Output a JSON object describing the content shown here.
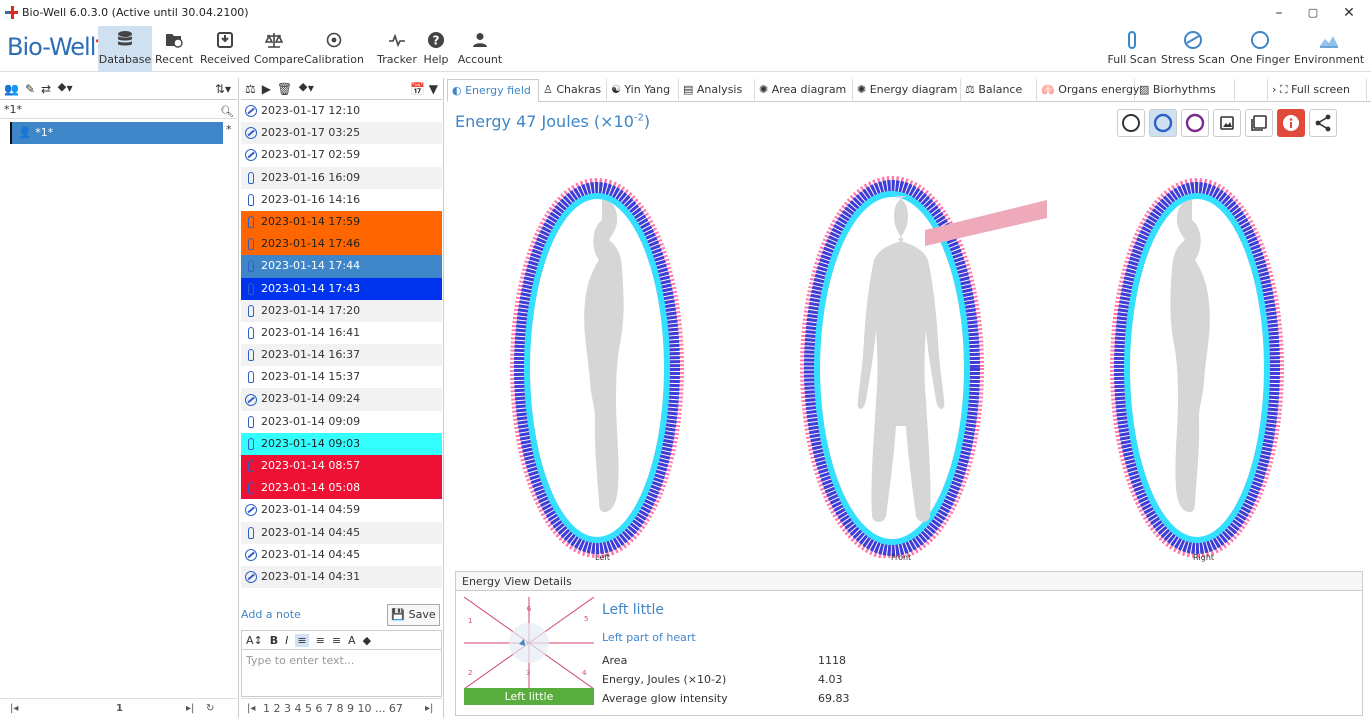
{
  "window": {
    "title": "Bio-Well 6.0.3.0 (Active until 30.04.2100)",
    "min": "–",
    "max": "▢",
    "close": "✕"
  },
  "brand": {
    "name": "Bio-Well",
    "mark": "✚"
  },
  "toolbar": {
    "left": [
      {
        "label": "Database",
        "icon": "database-icon"
      },
      {
        "label": "Recent",
        "icon": "recent-icon"
      },
      {
        "label": "Received",
        "icon": "received-icon"
      },
      {
        "label": "Compare",
        "icon": "compare-icon"
      },
      {
        "label": "Calibration",
        "icon": "calibration-icon"
      },
      {
        "label": "Tracker",
        "icon": "tracker-icon"
      },
      {
        "label": "Help",
        "icon": "help-icon"
      },
      {
        "label": "Account",
        "icon": "account-icon"
      }
    ],
    "right": [
      {
        "label": "Full Scan",
        "icon": "full-scan-icon"
      },
      {
        "label": "Stress Scan",
        "icon": "stress-scan-icon"
      },
      {
        "label": "One Finger",
        "icon": "one-finger-icon"
      },
      {
        "label": "Environment",
        "icon": "environment-icon"
      }
    ]
  },
  "people": {
    "search_value": "*1*",
    "selected_user": "*1*",
    "marker": "*",
    "page": "1"
  },
  "sessions": {
    "items": [
      {
        "label": "2023-01-17 12:10",
        "type": "stress",
        "color": ""
      },
      {
        "label": "2023-01-17 03:25",
        "type": "stress",
        "color": ""
      },
      {
        "label": "2023-01-17 02:59",
        "type": "stress",
        "color": ""
      },
      {
        "label": "2023-01-16 16:09",
        "type": "finger",
        "color": ""
      },
      {
        "label": "2023-01-16 14:16",
        "type": "finger",
        "color": ""
      },
      {
        "label": "2023-01-14 17:59",
        "type": "finger",
        "color": "orange"
      },
      {
        "label": "2023-01-14 17:46",
        "type": "finger",
        "color": "orange"
      },
      {
        "label": "2023-01-14 17:44",
        "type": "finger",
        "color": "steel"
      },
      {
        "label": "2023-01-14 17:43",
        "type": "finger",
        "color": "blue"
      },
      {
        "label": "2023-01-14 17:20",
        "type": "finger",
        "color": ""
      },
      {
        "label": "2023-01-14 16:41",
        "type": "finger",
        "color": ""
      },
      {
        "label": "2023-01-14 16:37",
        "type": "finger",
        "color": ""
      },
      {
        "label": "2023-01-14 15:37",
        "type": "finger",
        "color": ""
      },
      {
        "label": "2023-01-14 09:24",
        "type": "stress",
        "color": ""
      },
      {
        "label": "2023-01-14 09:09",
        "type": "finger",
        "color": ""
      },
      {
        "label": "2023-01-14 09:03",
        "type": "finger",
        "color": "cyan"
      },
      {
        "label": "2023-01-14 08:57",
        "type": "finger",
        "color": "red"
      },
      {
        "label": "2023-01-14 05:08",
        "type": "finger",
        "color": "red"
      },
      {
        "label": "2023-01-14 04:59",
        "type": "stress",
        "color": ""
      },
      {
        "label": "2023-01-14 04:45",
        "type": "finger",
        "color": ""
      },
      {
        "label": "2023-01-14 04:45",
        "type": "stress",
        "color": ""
      },
      {
        "label": "2023-01-14 04:31",
        "type": "stress",
        "color": ""
      }
    ],
    "add_note": "Add a note",
    "save": "Save",
    "note_placeholder": "Type to enter text...",
    "pages": "1 2 3 4 5 6 7 8 9 10 ... 67"
  },
  "tabs": [
    {
      "label": "Energy field",
      "active": true
    },
    {
      "label": "Chakras"
    },
    {
      "label": "Yin Yang"
    },
    {
      "label": "Analysis"
    },
    {
      "label": "Area diagram"
    },
    {
      "label": "Energy diagram"
    },
    {
      "label": "Balance"
    },
    {
      "label": "Organs energy"
    },
    {
      "label": "Biorhythms"
    },
    {
      "label": "Full screen"
    }
  ],
  "energy": {
    "title_prefix": "Energy 47 Joules (×10",
    "exp": "-2",
    "title_suffix": ")"
  },
  "views": {
    "left": "Left",
    "front": "Front",
    "right": "Right"
  },
  "details": {
    "header": "Energy View Details",
    "sector": "Left little",
    "description": "Left part of heart",
    "thumb_label": "Left little",
    "thumb_numbers": [
      "6",
      "1",
      "5",
      "2",
      "3",
      "4"
    ],
    "rows": [
      {
        "key": "Area",
        "value": "1118"
      },
      {
        "key": "Energy, Joules (×10-2)",
        "value": "4.03"
      },
      {
        "key": "Average glow intensity",
        "value": "69.83"
      }
    ]
  },
  "colors": {
    "accent": "#3f86c8",
    "orange": "#ff6600",
    "blue": "#0033ee",
    "cyan": "#33ffff",
    "red": "#ee1133",
    "green": "#59ad3c"
  }
}
